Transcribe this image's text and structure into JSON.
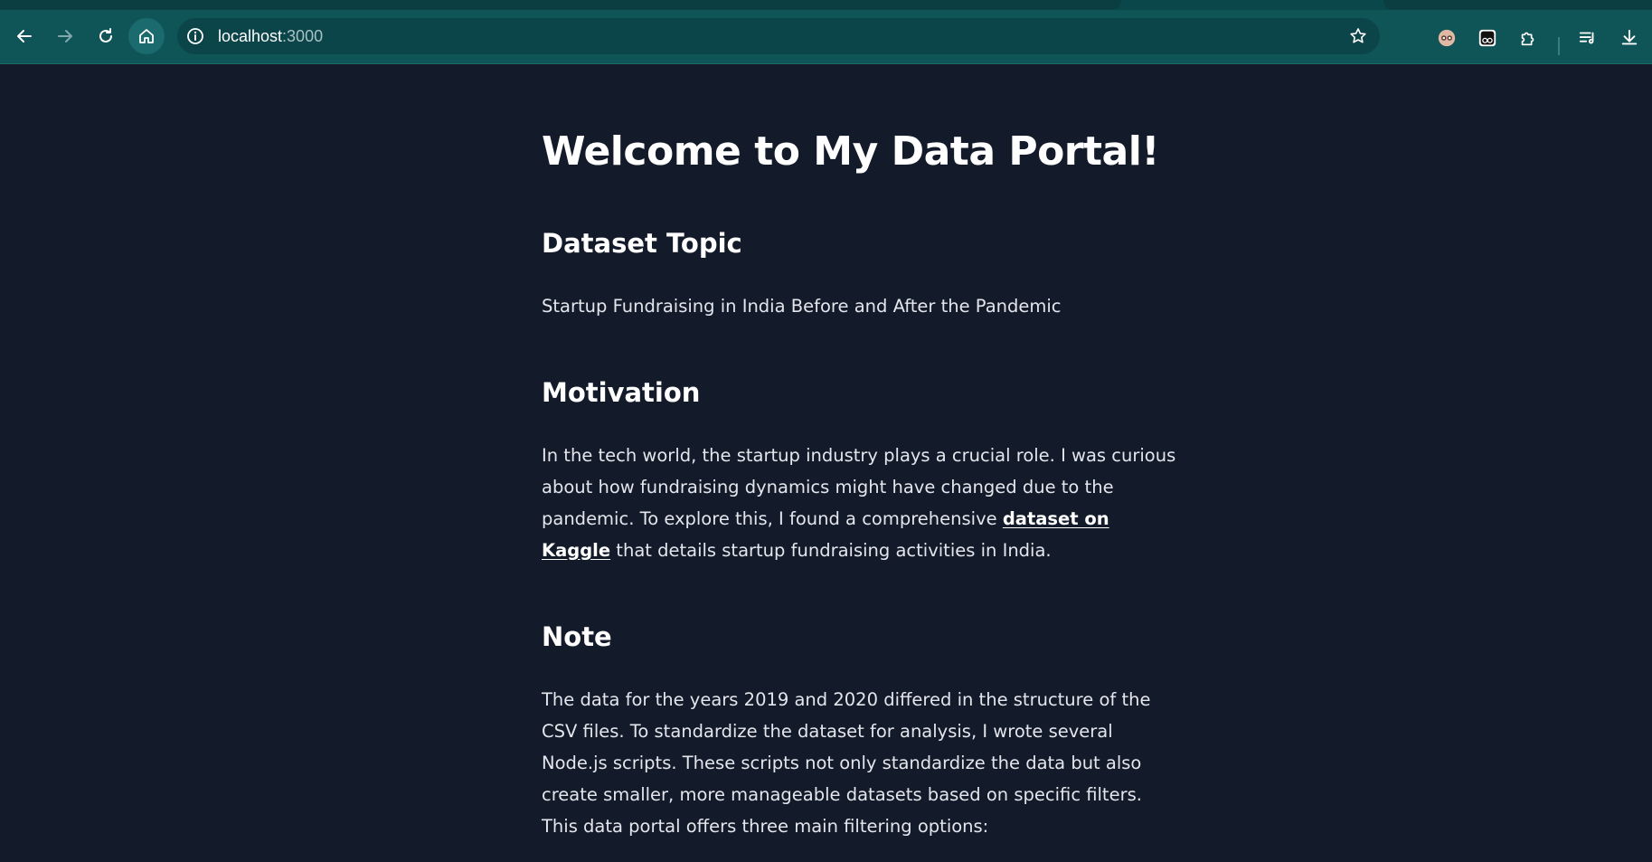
{
  "browser": {
    "url_host": "localhost",
    "url_port": ":3000",
    "icons": {
      "back": "arrow-left-icon",
      "forward": "arrow-right-icon",
      "reload": "reload-icon",
      "home": "home-icon",
      "site_info": "info-icon",
      "bookmark": "star-icon",
      "extensions": "puzzle-icon",
      "reading_list": "list-icon",
      "downloads": "download-icon"
    },
    "colors": {
      "frame": "#0f5457",
      "omnibox": "#0b4449",
      "page_background": "#131a29"
    }
  },
  "page": {
    "title": "Welcome to My Data Portal!",
    "sections": {
      "topic": {
        "heading": "Dataset Topic",
        "text": "Startup Fundraising in India Before and After the Pandemic"
      },
      "motivation": {
        "heading": "Motivation",
        "text_before": "In the tech world, the startup industry plays a crucial role. I was curious about how fundraising dynamics might have changed due to the pandemic. To explore this, I found a comprehensive ",
        "link": "dataset on Kaggle",
        "text_after": " that details startup fundraising activities in India."
      },
      "note": {
        "heading": "Note",
        "text": "The data for the years 2019 and 2020 differed in the structure of the CSV files. To standardize the dataset for analysis, I wrote several Node.js scripts. These scripts not only standardize the data but also create smaller, more manageable datasets based on specific filters. This data portal offers three main filtering options:"
      }
    }
  }
}
